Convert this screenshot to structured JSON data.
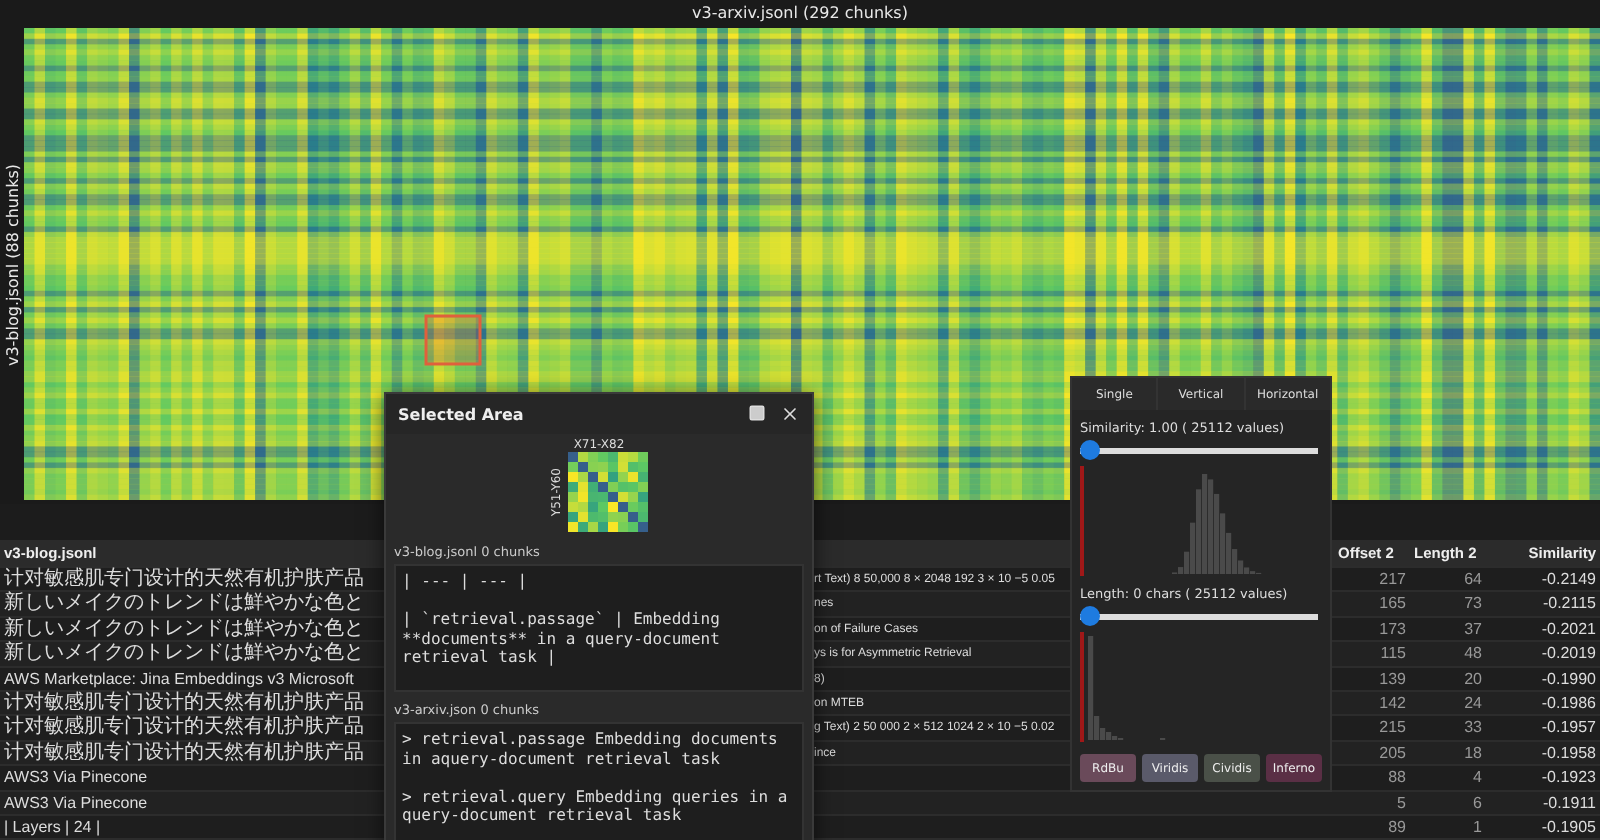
{
  "heatmap": {
    "title": "v3-arxiv.jsonl (292 chunks)",
    "y_label": "v3-blog.jsonl (88 chunks)"
  },
  "table": {
    "columns": [
      "v3-blog.jsonl",
      "Offset 2",
      "Length 2",
      "Similarity"
    ],
    "rows": [
      {
        "text_1": "计对敏感肌专门设计的天然有机护肤产品",
        "text_2": "rt Text) 8 50,000 8 × 2048 192 3 × 10 −5 0.05",
        "offset_2": "217",
        "length_2": "64",
        "similarity": "-0.2149"
      },
      {
        "text_1": "新しいメイクのトレンドは鮮やかな色と",
        "text_2": "nes",
        "offset_2": "165",
        "length_2": "73",
        "similarity": "-0.2115"
      },
      {
        "text_1": "新しいメイクのトレンドは鮮やかな色と",
        "text_2": "on of Failure Cases",
        "offset_2": "173",
        "length_2": "37",
        "similarity": "-0.2021"
      },
      {
        "text_1": "新しいメイクのトレンドは鮮やかな色と",
        "text_2": "ys is for Asymmetric Retrieval",
        "offset_2": "115",
        "length_2": "48",
        "similarity": "-0.2019"
      },
      {
        "text_1": "AWS Marketplace: Jina Embeddings v3 Microsoft",
        "text_2": "8)",
        "offset_2": "139",
        "length_2": "20",
        "similarity": "-0.1990"
      },
      {
        "text_1": "计对敏感肌专门设计的天然有机护肤产品",
        "text_2": "on MTEB",
        "offset_2": "142",
        "length_2": "24",
        "similarity": "-0.1986"
      },
      {
        "text_1": "计对敏感肌专门设计的天然有机护肤产品",
        "text_2": "g Text) 2 50 000 2 × 512 1024 2 × 10 −5 0.02",
        "offset_2": "215",
        "length_2": "33",
        "similarity": "-0.1957"
      },
      {
        "text_1": "计对敏感肌专门设计的天然有机护肤产品",
        "text_2": "ince",
        "offset_2": "205",
        "length_2": "18",
        "similarity": "-0.1958"
      },
      {
        "text_1": "AWS3 Via Pinecone",
        "offset_2": "88",
        "length_2": "4",
        "similarity": "-0.1923"
      },
      {
        "text_1": "AWS3 Via Pinecone",
        "offset_2": "5",
        "length_2": "6",
        "similarity": "-0.1911"
      },
      {
        "text_1": "| Layers | 24 |",
        "offset_2": "89",
        "length_2": "1",
        "similarity": "-0.1905"
      }
    ]
  },
  "selected_area": {
    "title": "Selected Area",
    "x_range": "X71-X82",
    "y_range": "Y51-Y60",
    "sections": [
      {
        "label": "v3-blog.jsonl 0 chunks",
        "value": "| --- | --- |\n\n| `retrieval.passage` | Embedding **documents** in a query-document retrieval task |"
      },
      {
        "label": "v3-arxiv.json 0 chunks",
        "value": "> retrieval.passage Embedding documents in aquery-document retrieval task\n\n> retrieval.query Embedding queries in a query-document retrieval task"
      }
    ]
  },
  "filter_panel": {
    "tabs": [
      {
        "label": "Single",
        "selected": false
      },
      {
        "label": "Vertical",
        "selected": false
      },
      {
        "label": "Horizontal",
        "selected": false
      }
    ],
    "sliders": [
      {
        "label": "Similarity: 1.00 ( 25112 values)",
        "level": 0
      },
      {
        "label": "Length: 0 chars ( 25112 values)",
        "level": 0
      }
    ],
    "colormaps": [
      {
        "label": "RdBu",
        "color": "#6a4a5a"
      },
      {
        "label": "Viridis",
        "color": "#5a5a6a"
      },
      {
        "label": "Cividis",
        "color": "#4a5048"
      },
      {
        "label": "Inferno",
        "color": "#5a2f45"
      }
    ]
  }
}
